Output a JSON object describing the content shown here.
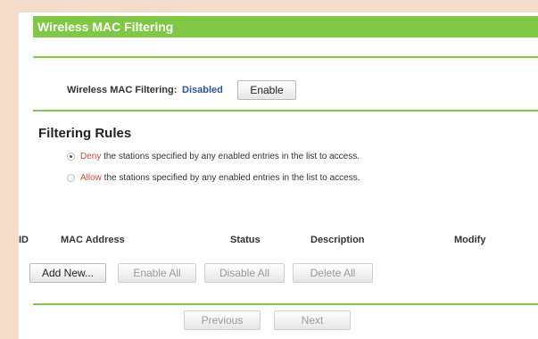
{
  "title": "Wireless MAC Filtering",
  "mac_filtering": {
    "label": "Wireless MAC Filtering:",
    "status": "Disabled",
    "enable_button": "Enable"
  },
  "filtering_rules": {
    "heading": "Filtering Rules",
    "options": [
      {
        "keyword": "Deny",
        "text": " the stations specified by any enabled entries in the list to access.",
        "checked": true
      },
      {
        "keyword": "Allow",
        "text": " the stations specified by any enabled entries in the list to access.",
        "checked": false
      }
    ]
  },
  "table": {
    "columns": [
      "ID",
      "MAC Address",
      "Status",
      "Description",
      "Modify"
    ]
  },
  "actions": {
    "add_new": "Add New...",
    "enable_all": "Enable All",
    "disable_all": "Disable All",
    "delete_all": "Delete All"
  },
  "pagination": {
    "previous": "Previous",
    "next": "Next"
  },
  "colors": {
    "accent": "#7fc843",
    "status_blue": "#2a55a0",
    "keyword_red": "#d6463b"
  }
}
